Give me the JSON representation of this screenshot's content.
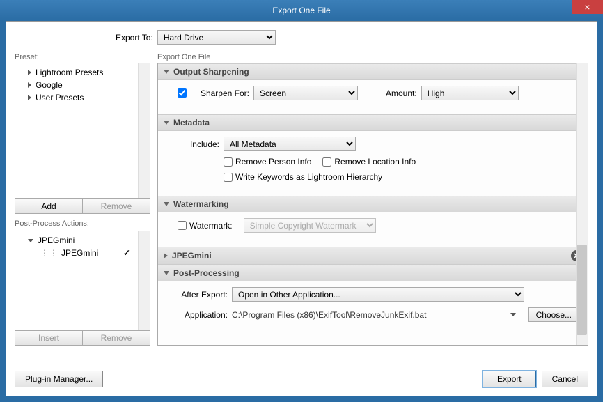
{
  "title": "Export One File",
  "exportTo": {
    "label": "Export To:",
    "value": "Hard Drive"
  },
  "preset": {
    "label": "Preset:",
    "items": [
      "Lightroom Presets",
      "Google",
      "User Presets"
    ],
    "addLabel": "Add",
    "removeLabel": "Remove"
  },
  "postProcess": {
    "label": "Post-Process Actions:",
    "group": "JPEGmini",
    "subitem": "JPEGmini",
    "insertLabel": "Insert",
    "removeLabel": "Remove"
  },
  "rightHeader": "Export One File",
  "sections": {
    "outputSharpening": {
      "title": "Output Sharpening",
      "sharpenForLabel": "Sharpen For:",
      "sharpenForValue": "Screen",
      "amountLabel": "Amount:",
      "amountValue": "High"
    },
    "metadata": {
      "title": "Metadata",
      "includeLabel": "Include:",
      "includeValue": "All Metadata",
      "removePerson": "Remove Person Info",
      "removeLocation": "Remove Location Info",
      "writeKeywords": "Write Keywords as Lightroom Hierarchy"
    },
    "watermarking": {
      "title": "Watermarking",
      "watermarkLabel": "Watermark:",
      "watermarkValue": "Simple Copyright Watermark"
    },
    "jpegmini": {
      "title": "JPEGmini"
    },
    "postProcessing": {
      "title": "Post-Processing",
      "afterExportLabel": "After Export:",
      "afterExportValue": "Open in Other Application...",
      "applicationLabel": "Application:",
      "applicationPath": "C:\\Program Files (x86)\\ExifTool\\RemoveJunkExif.bat",
      "chooseLabel": "Choose..."
    }
  },
  "buttons": {
    "pluginManager": "Plug-in Manager...",
    "export": "Export",
    "cancel": "Cancel"
  }
}
